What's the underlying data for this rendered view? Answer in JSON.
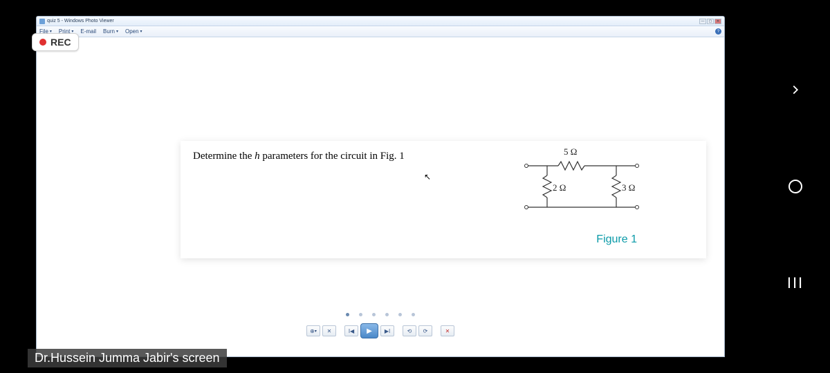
{
  "phone_nav": {
    "back": "‹",
    "home": "○",
    "recent": "III"
  },
  "window": {
    "title": "quiz 5 - Windows Photo Viewer",
    "winbtn_min": "—",
    "winbtn_max": "▢",
    "winbtn_close": "✕"
  },
  "menu": {
    "file": "File",
    "print": "Print",
    "email": "E-mail",
    "burn": "Burn",
    "open": "Open",
    "help": "?"
  },
  "rec": {
    "label": "REC"
  },
  "problem": {
    "prompt_pre": "Determine the ",
    "prompt_var": "h",
    "prompt_post": " parameters for the circuit in Fig. 1",
    "caption": "Figure 1",
    "r_top": "5 Ω",
    "r_left": "2 Ω",
    "r_right": "3 Ω"
  },
  "shared": {
    "caption": "Dr.Hussein Jumma Jabir's screen"
  },
  "controls": {
    "zoom": "⊕",
    "fit": "✕",
    "prev": "I◀",
    "play": "▶",
    "next": "▶I",
    "rot_ccw": "⟲",
    "rot_cw": "⟳",
    "delete": "✕"
  }
}
